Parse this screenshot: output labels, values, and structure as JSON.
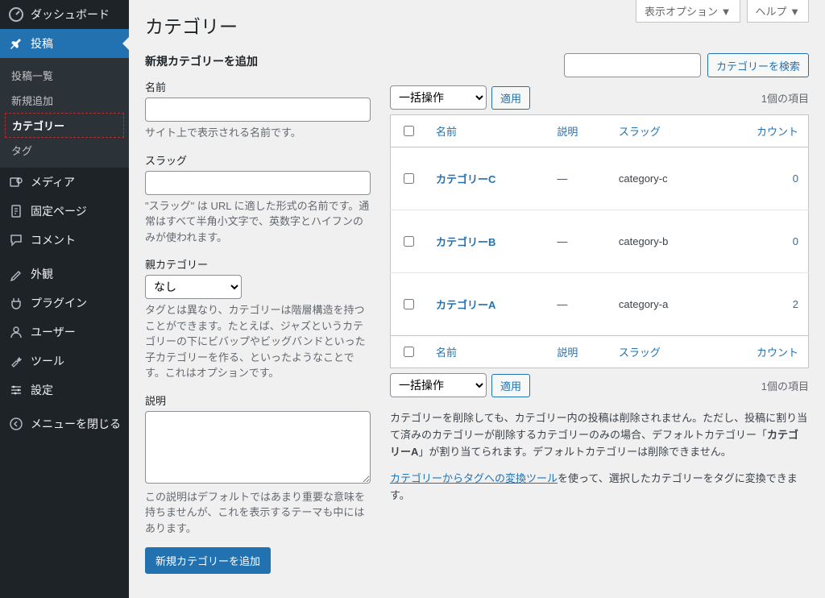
{
  "screen_meta": {
    "options_label": "表示オプション ▼",
    "help_label": "ヘルプ ▼"
  },
  "page_title": "カテゴリー",
  "sidebar": {
    "dashboard": "ダッシュボード",
    "posts": "投稿",
    "posts_sub": {
      "list": "投稿一覧",
      "new": "新規追加",
      "categories": "カテゴリー",
      "tags": "タグ"
    },
    "media": "メディア",
    "pages": "固定ページ",
    "comments": "コメント",
    "appearance": "外観",
    "plugins": "プラグイン",
    "users": "ユーザー",
    "tools": "ツール",
    "settings": "設定",
    "collapse": "メニューを閉じる"
  },
  "form": {
    "section_title": "新規カテゴリーを追加",
    "name_label": "名前",
    "name_help": "サイト上で表示される名前です。",
    "slug_label": "スラッグ",
    "slug_help": "\"スラッグ\" は URL に適した形式の名前です。通常はすべて半角小文字で、英数字とハイフンのみが使われます。",
    "parent_label": "親カテゴリー",
    "parent_option": "なし",
    "parent_help": "タグとは異なり、カテゴリーは階層構造を持つことができます。たとえば、ジャズというカテゴリーの下にビバップやビッグバンドといった子カテゴリーを作る、といったようなことです。これはオプションです。",
    "desc_label": "説明",
    "desc_help": "この説明はデフォルトではあまり重要な意味を持ちませんが、これを表示するテーマも中にはあります。",
    "submit_label": "新規カテゴリーを追加"
  },
  "table": {
    "search_button": "カテゴリーを検索",
    "bulk_label": "一括操作",
    "apply_label": "適用",
    "items_count": "1個の項目",
    "headers": {
      "name": "名前",
      "desc": "説明",
      "slug": "スラッグ",
      "count": "カウント"
    },
    "rows": [
      {
        "name": "カテゴリーC",
        "desc": "—",
        "slug": "category-c",
        "count": "0",
        "indent": false
      },
      {
        "name": "カテゴリーB",
        "desc": "—",
        "slug": "category-b",
        "count": "0",
        "indent": false
      },
      {
        "name": "カテゴリーA",
        "desc": "—",
        "slug": "category-a",
        "count": "2",
        "indent": true
      }
    ]
  },
  "notes": {
    "p1_a": "カテゴリーを削除しても、カテゴリー内の投稿は削除されません。ただし、投稿に割り当て済みのカテゴリーが削除するカテゴリーのみの場合、デフォルトカテゴリー「",
    "p1_b": "カテゴリーA",
    "p1_c": "」が割り当てられます。デフォルトカテゴリーは削除できません。",
    "p2_link": "カテゴリーからタグへの変換ツール",
    "p2_rest": "を使って、選択したカテゴリーをタグに変換できます。"
  }
}
